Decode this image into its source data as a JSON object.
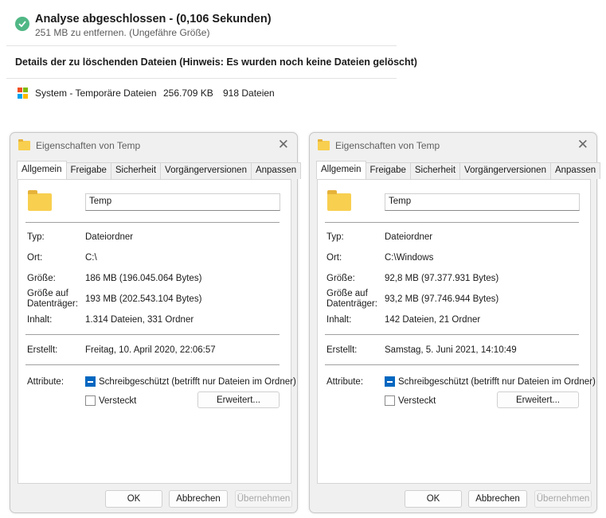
{
  "analysis": {
    "title": "Analyse abgeschlossen - (0,106 Sekunden)",
    "subtitle": "251 MB zu entfernen. (Ungefähre Größe)",
    "details_heading": "Details der zu löschenden Dateien (Hinweis: Es wurden noch keine Dateien gelöscht)",
    "category": {
      "name": "System - Temporäre Dateien",
      "size": "256.709 KB",
      "count": "918 Dateien"
    },
    "colors": {
      "check": "#50b785"
    }
  },
  "dialogs": [
    {
      "title": "Eigenschaften von Temp",
      "tabs": [
        "Allgemein",
        "Freigabe",
        "Sicherheit",
        "Vorgängerversionen",
        "Anpassen"
      ],
      "name": "Temp",
      "props": {
        "typ_label": "Typ:",
        "typ": "Dateiordner",
        "ort_label": "Ort:",
        "ort": "C:\\",
        "groesse_label": "Größe:",
        "groesse": "186 MB (196.045.064 Bytes)",
        "dt_label_1": "Größe auf",
        "dt_label_2": "Datenträger:",
        "dt": "193 MB (202.543.104 Bytes)",
        "inhalt_label": "Inhalt:",
        "inhalt": "1.314 Dateien, 331 Ordner",
        "erstellt_label": "Erstellt:",
        "erstellt": "Freitag, 10. April 2020, 22:06:57",
        "attribute_label": "Attribute:"
      },
      "readonly_label": "Schreibgeschützt (betrifft nur Dateien im Ordner)",
      "hidden_label": "Versteckt",
      "advanced_button": "Erweitert...",
      "buttons": {
        "ok": "OK",
        "cancel": "Abbrechen",
        "apply": "Übernehmen"
      }
    },
    {
      "title": "Eigenschaften von Temp",
      "tabs": [
        "Allgemein",
        "Freigabe",
        "Sicherheit",
        "Vorgängerversionen",
        "Anpassen"
      ],
      "name": "Temp",
      "props": {
        "typ_label": "Typ:",
        "typ": "Dateiordner",
        "ort_label": "Ort:",
        "ort": "C:\\Windows",
        "groesse_label": "Größe:",
        "groesse": "92,8 MB (97.377.931 Bytes)",
        "dt_label_1": "Größe auf",
        "dt_label_2": "Datenträger:",
        "dt": "93,2 MB (97.746.944 Bytes)",
        "inhalt_label": "Inhalt:",
        "inhalt": "142 Dateien, 21 Ordner",
        "erstellt_label": "Erstellt:",
        "erstellt": "Samstag, 5. Juni 2021, 14:10:49",
        "attribute_label": "Attribute:"
      },
      "readonly_label": "Schreibgeschützt (betrifft nur Dateien im Ordner)",
      "hidden_label": "Versteckt",
      "advanced_button": "Erweitert...",
      "buttons": {
        "ok": "OK",
        "cancel": "Abbrechen",
        "apply": "Übernehmen"
      }
    }
  ]
}
